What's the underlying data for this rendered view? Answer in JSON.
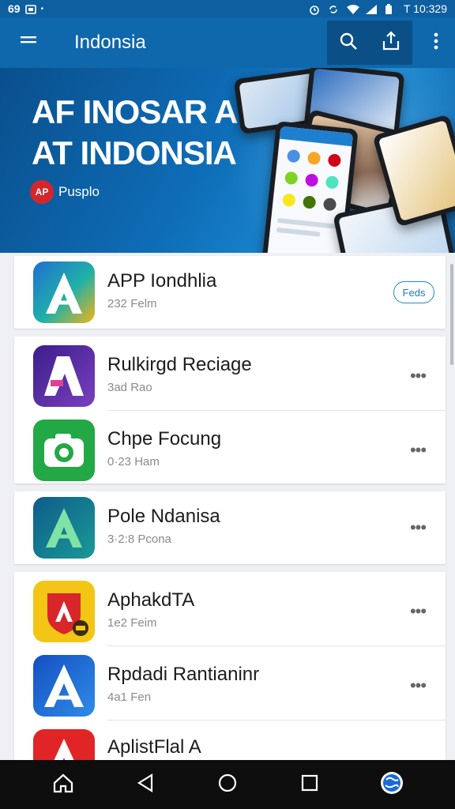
{
  "status_bar": {
    "left_text": "69",
    "time": "T 10:329"
  },
  "app_bar": {
    "title": "Indonsia",
    "menu_icon": "hamburger-menu-icon",
    "actions": [
      "search-icon",
      "share-icon",
      "more-vert-icon"
    ]
  },
  "banner": {
    "title_line1": "AF INOSAR A",
    "title_line2": "AT INDONSIA",
    "badge_logo": "AP",
    "badge_text": "Pusplo",
    "accent_color": "#0e6cb6"
  },
  "apps": [
    {
      "name": "APP Iondhlia",
      "meta": "232 Felm",
      "action": "Feds",
      "icon": "triangle-a-icon",
      "icon_bg": "#2a7fd1"
    },
    {
      "name": "Rulkirgd Reciage",
      "meta": "3ad Rao",
      "icon": "purple-a-icon",
      "icon_bg": "#5b2aa0"
    },
    {
      "name": "Chpe Focung",
      "meta": "0·23 Ham",
      "icon": "camera-icon",
      "icon_bg": "#22a845"
    },
    {
      "name": "Pole Ndanisa",
      "meta": "3·2:8 Pcona",
      "icon": "teal-a-icon",
      "icon_bg": "#17739a"
    },
    {
      "name": "AphakdTA",
      "meta": "1e2 Feim",
      "icon": "shield-a-icon",
      "icon_bg": "#f3c615"
    },
    {
      "name": "Rpdadi Rantianinr",
      "meta": "4a1 Fen",
      "icon": "blue-a-icon",
      "icon_bg": "#1a6ad6"
    },
    {
      "name": "AplistFlal A",
      "meta": "",
      "icon": "red-a-icon",
      "icon_bg": "#e12526"
    }
  ],
  "nav": [
    "home-icon",
    "back-icon",
    "circle-home-icon",
    "recents-icon",
    "globe-icon"
  ]
}
